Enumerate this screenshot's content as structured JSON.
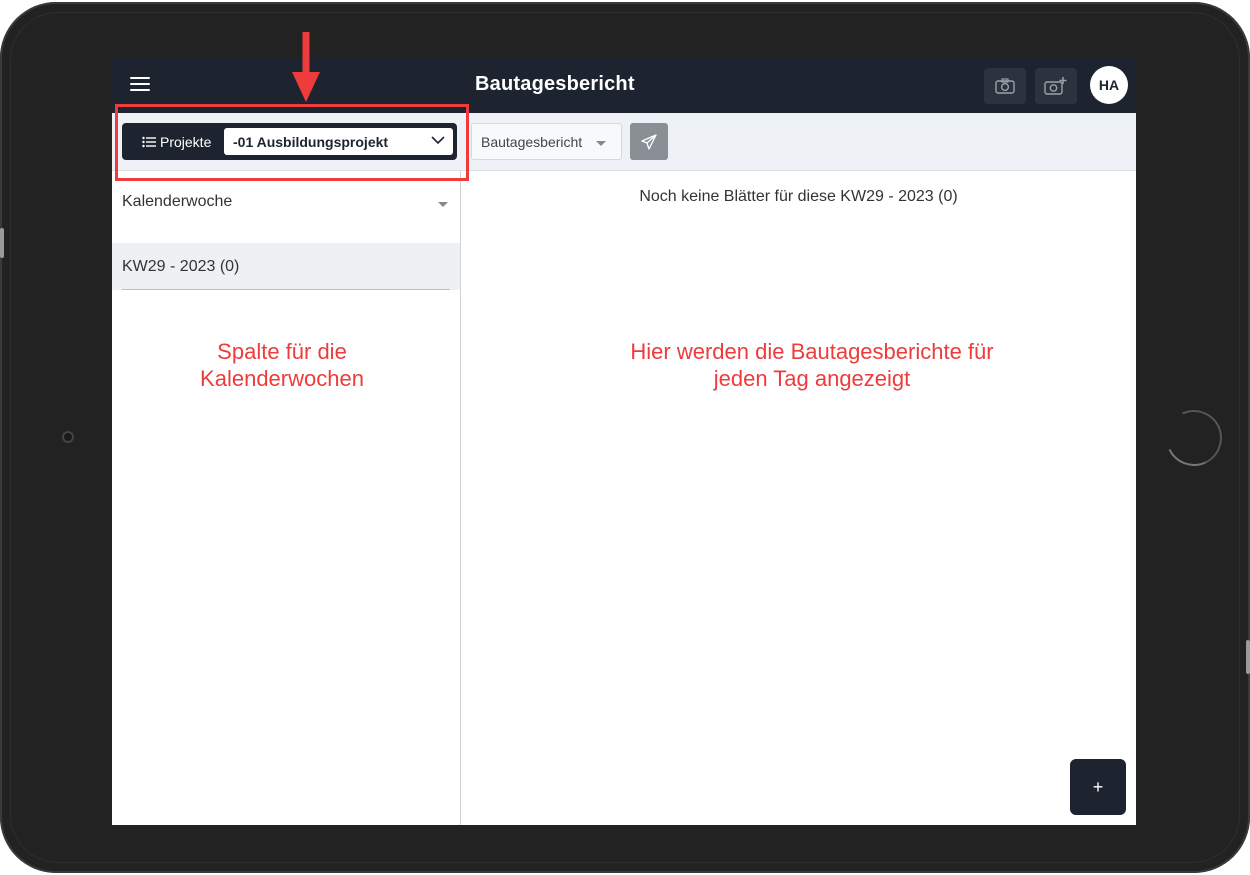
{
  "header": {
    "title": "Bautagesbericht",
    "avatar_initials": "HA"
  },
  "toolbar": {
    "projects_label": "Projekte",
    "project_selected": "-01 Ausbildungsprojekt",
    "report_type": "Bautagesbericht"
  },
  "left_panel": {
    "week_select_label": "Kalenderwoche",
    "weeks": [
      {
        "label": "KW29 - 2023 (0)"
      }
    ]
  },
  "main": {
    "empty_message": "Noch keine Blätter für diese KW29 - 2023 (0)"
  },
  "annotations": {
    "left_line1": "Spalte für die",
    "left_line2": "Kalenderwochen",
    "main_line1": "Hier werden die Bautagesberichte für",
    "main_line2": "jeden Tag angezeigt"
  },
  "fab": {
    "label": "+"
  },
  "colors": {
    "dark_navy": "#1d2430",
    "annotation_red": "#ee3b3b",
    "toolbar_bg": "#eef1f5"
  },
  "icons": {
    "menu": "hamburger-icon",
    "camera": "camera-icon",
    "camera_add": "camera-add-icon",
    "list": "list-icon",
    "chevron": "chevron-down-icon",
    "send": "paper-plane-icon"
  }
}
